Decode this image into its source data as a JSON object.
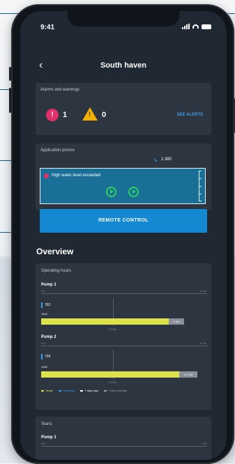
{
  "status": {
    "time": "9:41"
  },
  "nav": {
    "back_icon": "chevron-left-icon",
    "title": "South haven"
  },
  "alarms": {
    "title": "Alarms and warnings",
    "alarm_count": "1",
    "warning_count": "0",
    "see_alerts": "SEE ALERTS",
    "alarm_color": "#e2306a",
    "warning_color": "#f4b000"
  },
  "application": {
    "title": "Application picture",
    "level": "1.380",
    "highlight": "High water level exceeded",
    "pump_color": "#2ed35f"
  },
  "remote": {
    "label": "REMOTE CONTROL",
    "color": "#1588d2"
  },
  "overview": {
    "title": "Overview",
    "operating_hours": {
      "title": "Operating hours",
      "pumps": [
        {
          "name": "Pump 1",
          "sub": "h/d",
          "max": "6 h/d",
          "th_value": "762",
          "th_sub": "1000",
          "bar_fraction": 0.86,
          "bar_label": "3 h/d",
          "tick_value": "1 500h"
        },
        {
          "name": "Pump 2",
          "sub": "h/d",
          "max": "6 h/d",
          "th_value": "726",
          "th_sub": "1000",
          "bar_fraction": 0.94,
          "bar_label": "4.1 h/d",
          "tick_value": "1 500h"
        }
      ],
      "legend": [
        "Today",
        "Yesterday",
        "7 days ago",
        "7 days average"
      ]
    },
    "starts": {
      "title": "Starts",
      "pump": "Pump 1",
      "sub": "h/d",
      "max": "6/h"
    }
  }
}
